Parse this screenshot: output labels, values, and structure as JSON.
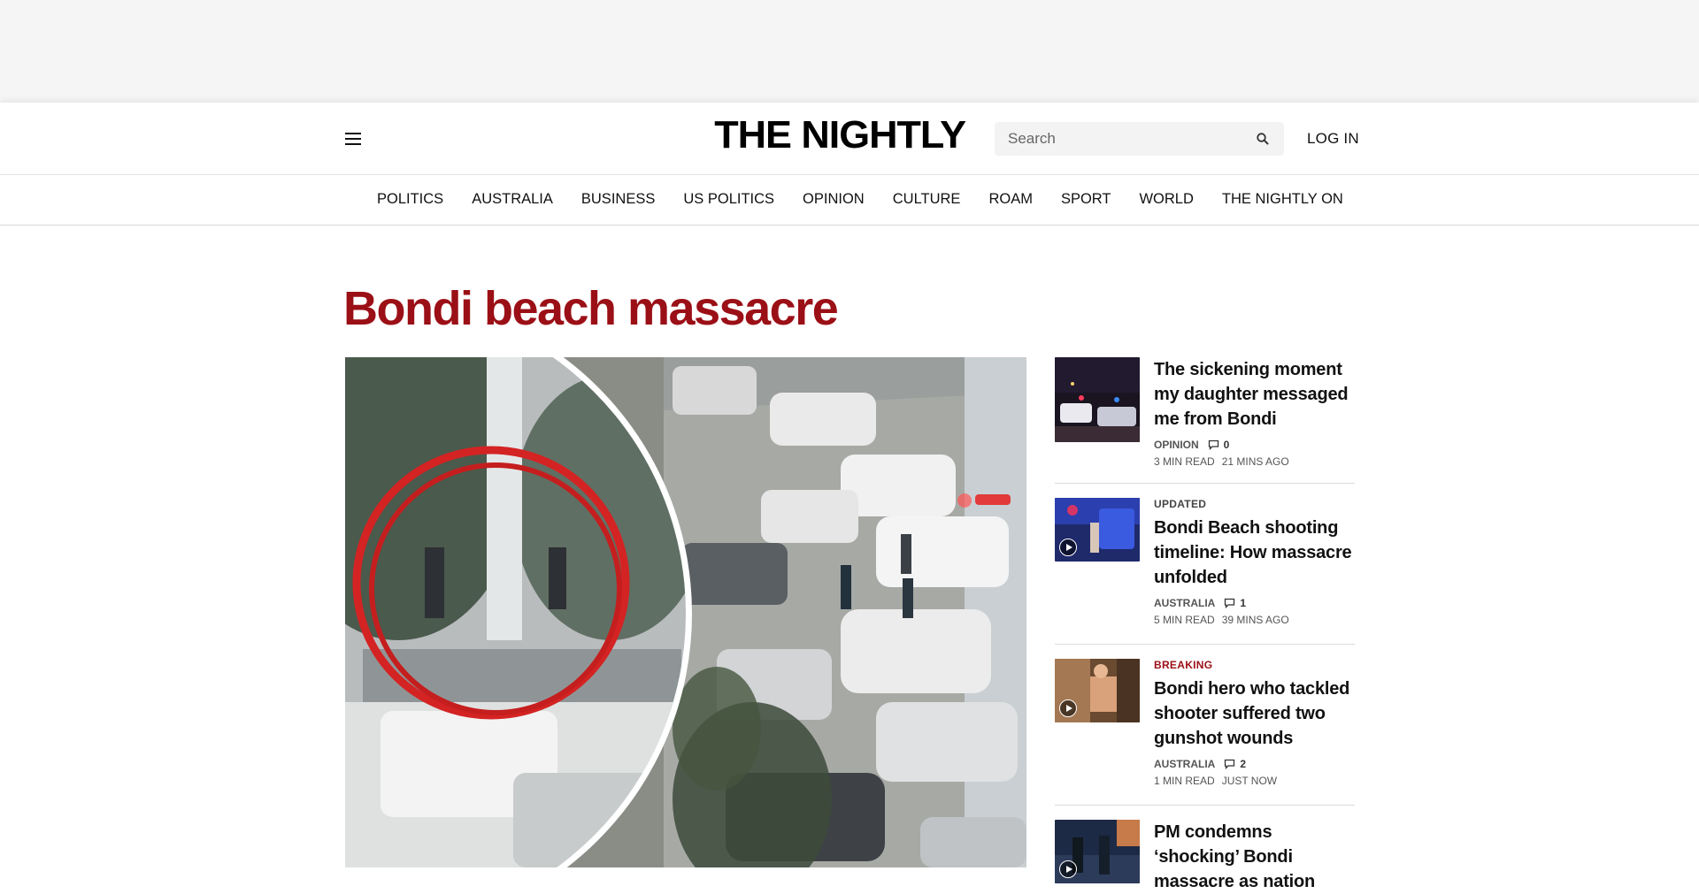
{
  "header": {
    "logo_text": "THE NIGHTLY",
    "search_placeholder": "Search",
    "login_label": "LOG IN"
  },
  "nav": {
    "items": [
      "POLITICS",
      "AUSTRALIA",
      "BUSINESS",
      "US POLITICS",
      "OPINION",
      "CULTURE",
      "ROAM",
      "SPORT",
      "WORLD",
      "THE NIGHTLY ON"
    ]
  },
  "page": {
    "section_title": "Bondi beach massacre"
  },
  "sidebar": {
    "stories": [
      {
        "kicker": "",
        "headline": "The sickening moment my daughter messaged me from Bondi",
        "category": "OPINION",
        "comments": "0",
        "read_time": "3 MIN READ",
        "time_ago": "21 MINS AGO",
        "has_video": false
      },
      {
        "kicker": "UPDATED",
        "headline": "Bondi Beach shooting timeline: How massacre unfolded",
        "category": "AUSTRALIA",
        "comments": "1",
        "read_time": "5 MIN READ",
        "time_ago": "39 MINS AGO",
        "has_video": true
      },
      {
        "kicker": "BREAKING",
        "headline": "Bondi hero who tackled shooter suffered two gunshot wounds",
        "category": "AUSTRALIA",
        "comments": "2",
        "read_time": "1 MIN READ",
        "time_ago": "JUST NOW",
        "has_video": true
      },
      {
        "kicker": "",
        "headline": "PM condemns ‘shocking’ Bondi massacre as nation",
        "has_video": true
      }
    ]
  },
  "colors": {
    "accent": "#9b0f16",
    "text": "#111111",
    "ad_background": "#f5f5f5"
  },
  "icons": {
    "menu": "hamburger-icon",
    "search": "magnifier-icon",
    "comment": "speech-bubble-icon",
    "video": "play-icon"
  }
}
